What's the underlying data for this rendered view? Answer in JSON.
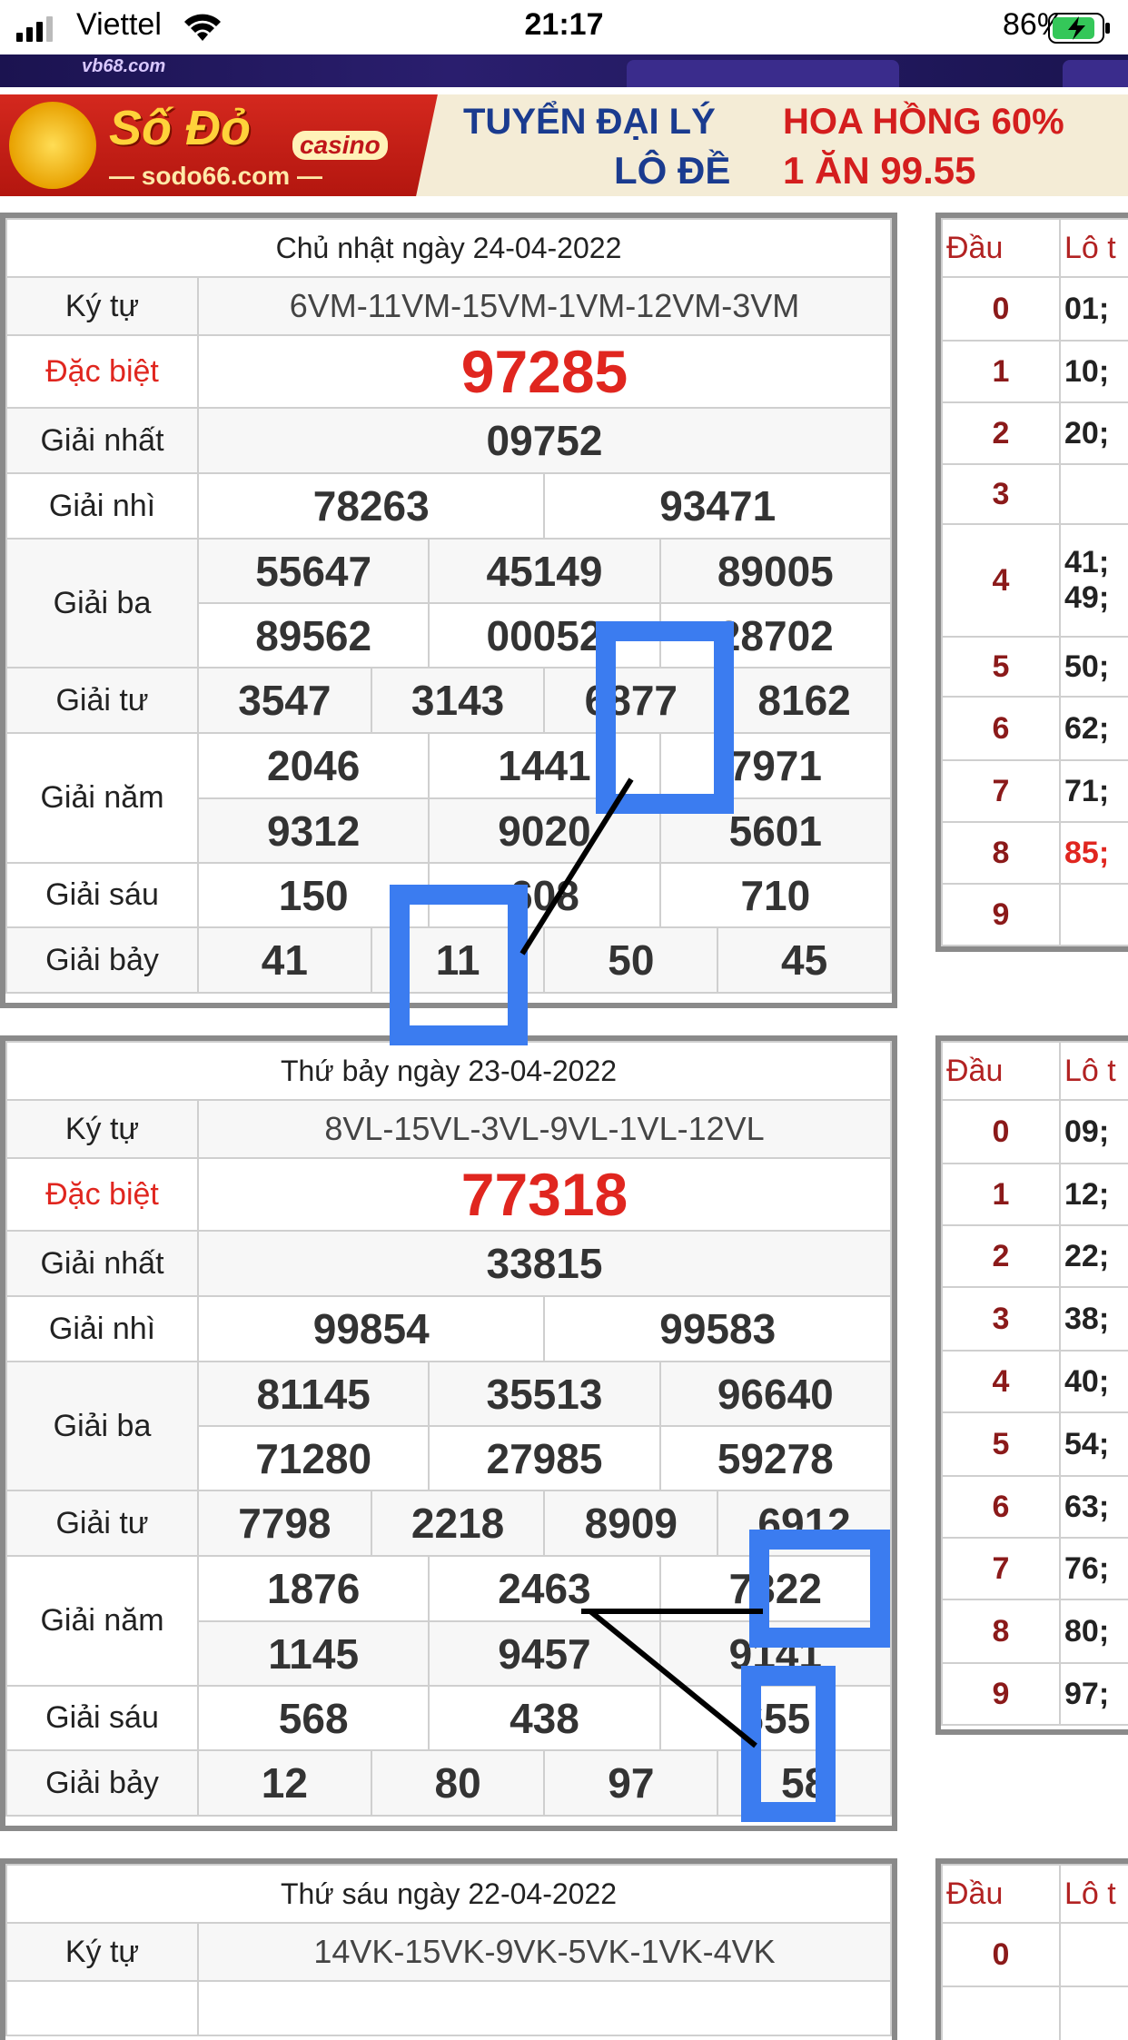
{
  "status_bar": {
    "carrier": "Viettel",
    "time": "21:17",
    "battery": "86%"
  },
  "banner_top": {
    "logo": "vb68.com"
  },
  "banner_ad": {
    "brand": "Số Đỏ",
    "brand_badge": "casino",
    "site": "— sodo66.com —",
    "line1_left": "TUYỂN ĐẠI LÝ",
    "line1_right": "HOA HỒNG 60%",
    "line2_left": "LÔ ĐỀ",
    "line2_right": "1 ĂN 99.55"
  },
  "labels": {
    "ky_tu": "Ký tự",
    "dac_biet": "Đặc biệt",
    "giai_nhat": "Giải nhất",
    "giai_nhi": "Giải nhì",
    "giai_ba": "Giải ba",
    "giai_tu": "Giải tư",
    "giai_nam": "Giải năm",
    "giai_sau": "Giải sáu",
    "giai_bay": "Giải bảy",
    "dau": "Đầu",
    "lo": "Lô t"
  },
  "results": [
    {
      "date": "Chủ nhật ngày 24-04-2022",
      "ky_tu": "6VM-11VM-15VM-1VM-12VM-3VM",
      "dac_biet": "97285",
      "giai_nhat": "09752",
      "giai_nhi": [
        "78263",
        "93471"
      ],
      "giai_ba": [
        "55647",
        "45149",
        "89005",
        "89562",
        "00052",
        "28702"
      ],
      "giai_tu": [
        "3547",
        "3143",
        "6877",
        "8162"
      ],
      "giai_nam": [
        "2046",
        "1441",
        "7971",
        "9312",
        "9020",
        "5601"
      ],
      "giai_sau": [
        "150",
        "608",
        "710"
      ],
      "giai_bay": [
        "41",
        "11",
        "50",
        "45"
      ],
      "dau": [
        {
          "d": "0",
          "lo": "01;"
        },
        {
          "d": "1",
          "lo": "10;"
        },
        {
          "d": "2",
          "lo": "20;"
        },
        {
          "d": "3",
          "lo": ""
        },
        {
          "d": "4",
          "lo": "41;",
          "lo2": "49;"
        },
        {
          "d": "5",
          "lo": "50;"
        },
        {
          "d": "6",
          "lo": "62;"
        },
        {
          "d": "7",
          "lo": "71;"
        },
        {
          "d": "8",
          "lo": "85;",
          "red": true
        },
        {
          "d": "9",
          "lo": ""
        }
      ]
    },
    {
      "date": "Thứ bảy ngày 23-04-2022",
      "ky_tu": "8VL-15VL-3VL-9VL-1VL-12VL",
      "dac_biet": "77318",
      "giai_nhat": "33815",
      "giai_nhi": [
        "99854",
        "99583"
      ],
      "giai_ba": [
        "81145",
        "35513",
        "96640",
        "71280",
        "27985",
        "59278"
      ],
      "giai_tu": [
        "7798",
        "2218",
        "8909",
        "6912"
      ],
      "giai_nam": [
        "1876",
        "2463",
        "7322",
        "1145",
        "9457",
        "9141"
      ],
      "giai_sau": [
        "568",
        "438",
        "655"
      ],
      "giai_bay": [
        "12",
        "80",
        "97",
        "58"
      ],
      "dau": [
        {
          "d": "0",
          "lo": "09;"
        },
        {
          "d": "1",
          "lo": "12;"
        },
        {
          "d": "2",
          "lo": "22;"
        },
        {
          "d": "3",
          "lo": "38;"
        },
        {
          "d": "4",
          "lo": "40;"
        },
        {
          "d": "5",
          "lo": "54;"
        },
        {
          "d": "6",
          "lo": "63;"
        },
        {
          "d": "7",
          "lo": "76;"
        },
        {
          "d": "8",
          "lo": "80;"
        },
        {
          "d": "9",
          "lo": "97;"
        }
      ]
    },
    {
      "date": "Thứ sáu ngày 22-04-2022",
      "ky_tu": "14VK-15VK-9VK-5VK-1VK-4VK",
      "dau": [
        {
          "d": "0",
          "lo": ""
        }
      ]
    }
  ]
}
